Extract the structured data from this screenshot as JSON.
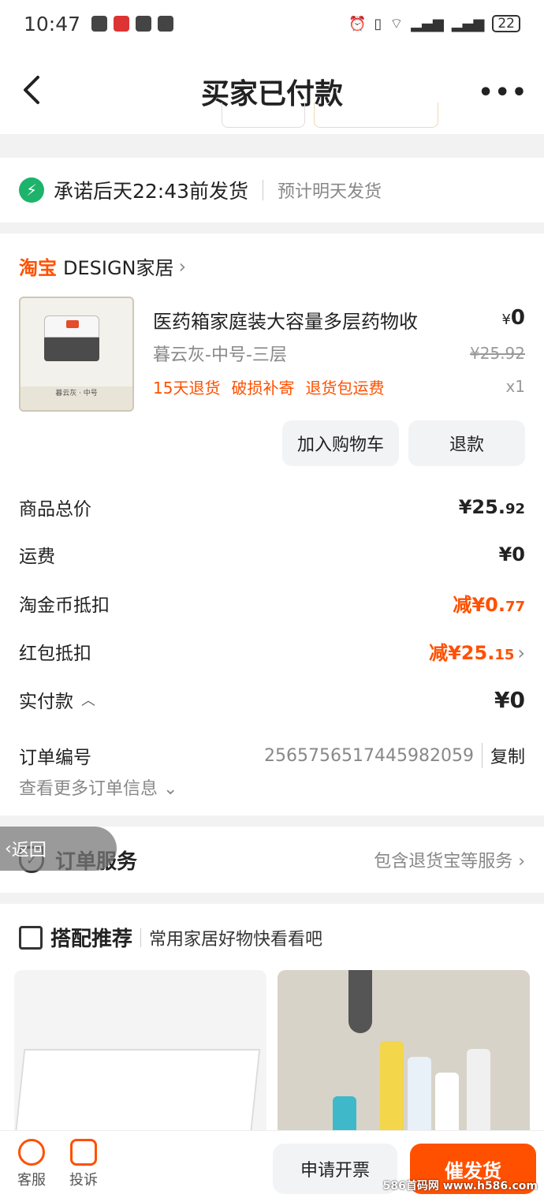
{
  "status": {
    "time": "10:47",
    "battery": "22"
  },
  "nav": {
    "title": "买家已付款",
    "more": "•••"
  },
  "shipping": {
    "promise": "承诺后天22:43前发货",
    "estimate": "预计明天发货"
  },
  "shop": {
    "platform": "淘宝",
    "name": "DESIGN家居"
  },
  "product": {
    "name": "医药箱家庭装大容量多层药物收",
    "price_symbol": "¥",
    "price": "0",
    "sku": "暮云灰-中号-三层",
    "original_price": "¥25.92",
    "tags": [
      "15天退货",
      "破损补寄",
      "退货包运费"
    ],
    "qty": "x1",
    "thumb_caption": "暮云灰 · 中号"
  },
  "actions": {
    "add_cart": "加入购物车",
    "refund": "退款"
  },
  "summary": {
    "goods_total_label": "商品总价",
    "goods_total_int": "¥25.",
    "goods_total_dec": "92",
    "shipping_label": "运费",
    "shipping_val": "¥0",
    "coin_label": "淘金币抵扣",
    "coin_int": "减¥0.",
    "coin_dec": "77",
    "redpack_label": "红包抵扣",
    "redpack_int": "减¥25.",
    "redpack_dec": "15",
    "paid_label": "实付款",
    "paid_val": "¥0",
    "order_no_label": "订单编号",
    "order_no": "2565756517445982059",
    "copy": "复制",
    "more_info": "查看更多订单信息"
  },
  "service": {
    "back": "返回",
    "title": "订单服务",
    "detail": "包含退货宝等服务"
  },
  "recommend": {
    "title": "搭配推荐",
    "subtitle": "常用家居好物快看看吧"
  },
  "bottom": {
    "service": "客服",
    "complain": "投诉",
    "invoice": "申请开票",
    "urge": "催发货"
  },
  "watermark": "586首码网 www.h586.com"
}
